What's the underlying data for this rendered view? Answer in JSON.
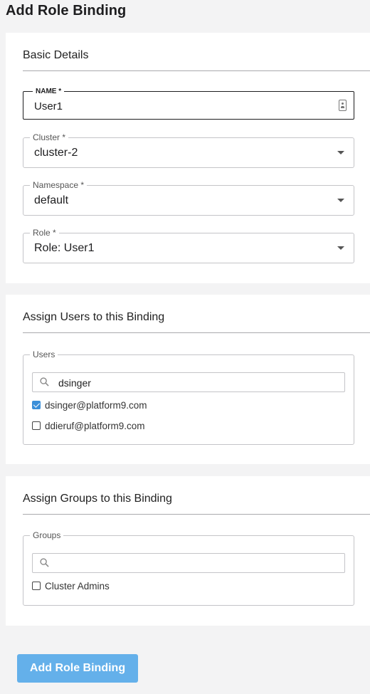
{
  "page": {
    "title": "Add Role Binding"
  },
  "basic_details": {
    "title": "Basic Details",
    "name": {
      "label": "NAME *",
      "value": "User1"
    },
    "cluster": {
      "label": "Cluster *",
      "value": "cluster-2"
    },
    "namespace": {
      "label": "Namespace *",
      "value": "default"
    },
    "role": {
      "label": "Role *",
      "value": "Role: User1"
    }
  },
  "users_section": {
    "title": "Assign Users to this Binding",
    "field_label": "Users",
    "search_value": "dsinger",
    "items": [
      {
        "label": "dsinger@platform9.com",
        "checked": true
      },
      {
        "label": "ddieruf@platform9.com",
        "checked": false
      }
    ]
  },
  "groups_section": {
    "title": "Assign Groups to this Binding",
    "field_label": "Groups",
    "search_value": "",
    "items": [
      {
        "label": "Cluster Admins",
        "checked": false
      }
    ]
  },
  "actions": {
    "submit_label": "Add Role Binding"
  },
  "colors": {
    "accent": "#3a8fd9",
    "primary_button": "#64b0ea"
  }
}
